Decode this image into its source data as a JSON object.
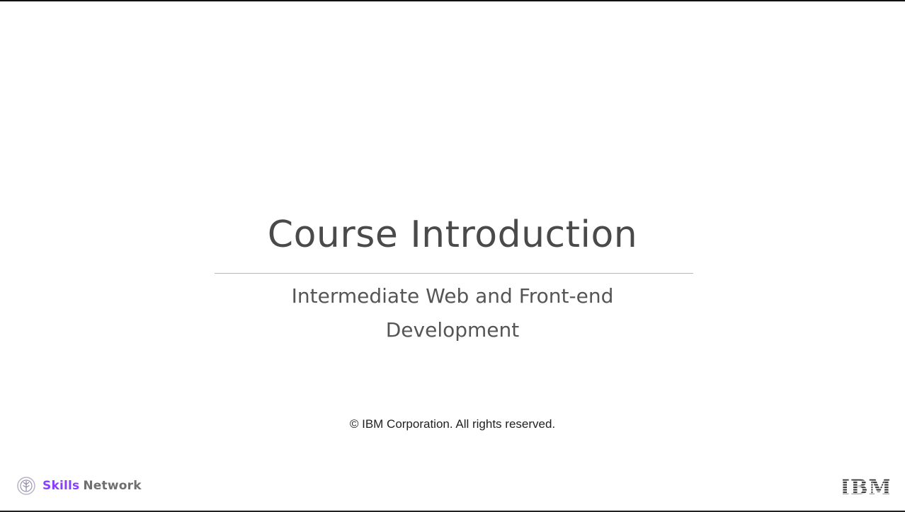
{
  "slide": {
    "title": "Course Introduction",
    "subtitle_line1": "Intermediate Web and Front-end",
    "subtitle_line2": "Development",
    "copyright": "© IBM Corporation. All rights reserved."
  },
  "footer": {
    "brand_left": {
      "word1": "Skills",
      "word2": "Network",
      "icon": "skills-network-logo-icon"
    },
    "brand_right": {
      "logo_text": "IBM",
      "icon": "ibm-logo-icon"
    }
  },
  "colors": {
    "skills_purple": "#8a3ffc",
    "network_gray": "#6f6f6f",
    "title_gray": "#4a4a4a"
  }
}
